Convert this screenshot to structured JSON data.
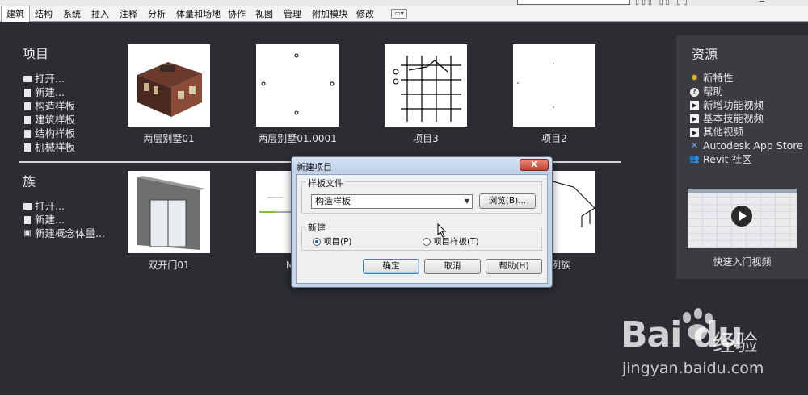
{
  "ribbon": {
    "tabs": [
      "建筑",
      "结构",
      "系统",
      "插入",
      "注释",
      "分析",
      "体量和场地",
      "协作",
      "视图",
      "管理",
      "附加模块",
      "修改"
    ],
    "active_tab": "建筑"
  },
  "projects": {
    "title": "项目",
    "links": [
      "打开...",
      "新建...",
      "构造样板",
      "建筑样板",
      "结构样板",
      "机械样板"
    ],
    "recent": [
      "两层别墅01",
      "两层别墅01.0001",
      "项目3",
      "项目2"
    ]
  },
  "families": {
    "title": "族",
    "links": [
      "打开...",
      "新建...",
      "新建概念体量..."
    ],
    "recent": [
      "双开门01",
      "M_车",
      "详例族"
    ]
  },
  "resources": {
    "title": "资源",
    "links": [
      "新特性",
      "帮助",
      "新增功能视频",
      "基本技能视频",
      "其他视频",
      "Autodesk App Store",
      "Revit 社区"
    ],
    "video_label": "快速入门视频"
  },
  "dialog": {
    "title": "新建项目",
    "close": "X",
    "template_group": "样板文件",
    "template_value": "构造样板",
    "browse": "浏览(B)...",
    "new_group": "新建",
    "radio_project": "项目(P)",
    "radio_template": "项目样板(T)",
    "ok": "确定",
    "cancel": "取消",
    "help": "帮助(H)"
  },
  "watermark": {
    "logo": "Bai du",
    "cn": "经验",
    "url": "jingyan.baidu.com"
  },
  "colors": {
    "background": "#2b2d33",
    "panel": "#3a3c42",
    "dialog_frame": "#c6d6ea",
    "close_button": "#c2412e"
  }
}
